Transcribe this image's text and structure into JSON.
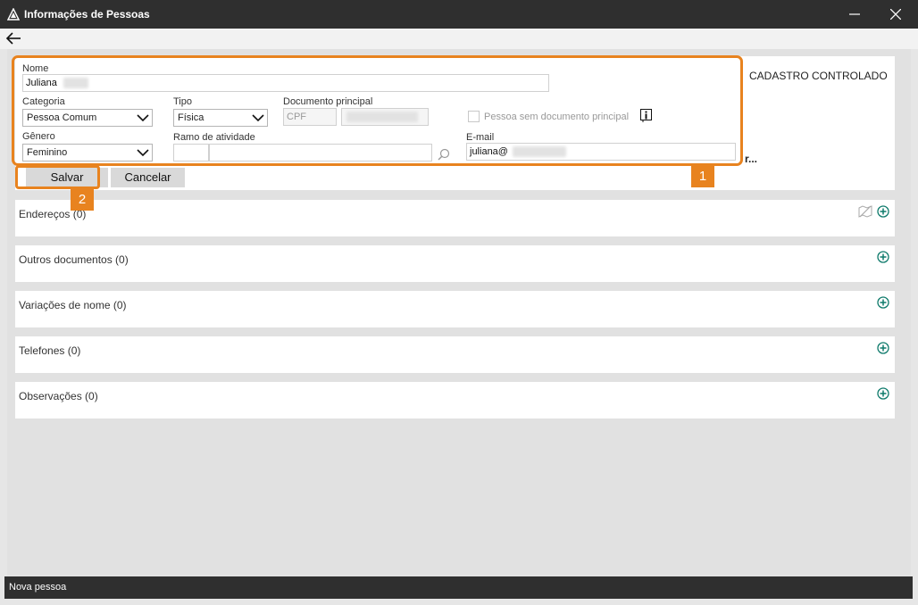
{
  "window": {
    "title": "Informações de Pessoas"
  },
  "form": {
    "nome_label": "Nome",
    "nome_value": "Juliana",
    "categoria_label": "Categoria",
    "categoria_value": "Pessoa Comum",
    "tipo_label": "Tipo",
    "tipo_value": "Física",
    "documento_label": "Documento principal",
    "documento_type": "CPF",
    "sem_documento_label": "Pessoa sem documento principal",
    "genero_label": "Gênero",
    "genero_value": "Feminino",
    "ramo_label": "Ramo de atividade",
    "email_label": "E-mail",
    "email_value": "juliana@",
    "cadastro_text": "CADASTRO CONTROLADO",
    "truncated_text": "r..."
  },
  "buttons": {
    "salvar": "Salvar",
    "cancelar": "Cancelar"
  },
  "callouts": {
    "one": "1",
    "two": "2"
  },
  "sections": [
    {
      "title": "Endereços (0)"
    },
    {
      "title": "Outros documentos (0)"
    },
    {
      "title": "Variações de nome (0)"
    },
    {
      "title": "Telefones (0)"
    },
    {
      "title": "Observações (0)"
    }
  ],
  "status": {
    "text": "Nova pessoa"
  },
  "colors": {
    "highlight": "#e8831f",
    "add_icon": "#0e7a6b",
    "titlebar": "#2f2f2f"
  }
}
